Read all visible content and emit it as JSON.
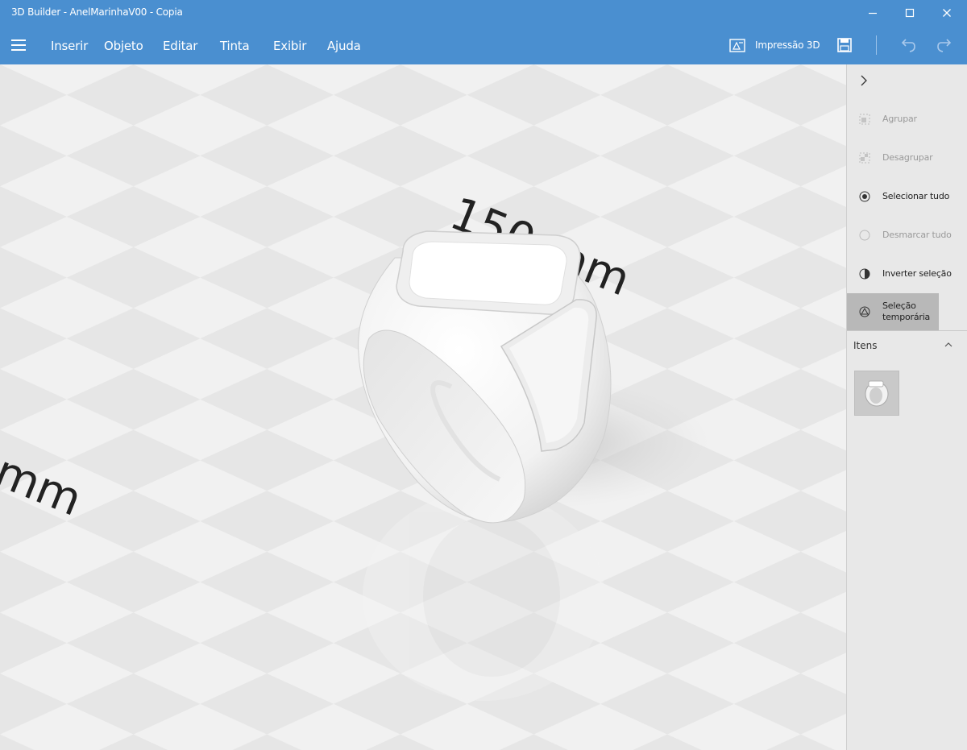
{
  "window": {
    "title": "3D Builder - AnelMarinhaV00 - Copia"
  },
  "menu": {
    "items": [
      "Inserir",
      "Objeto",
      "Editar",
      "Tinta",
      "Exibir",
      "Ajuda"
    ],
    "print_label": "Impressão 3D"
  },
  "viewport": {
    "ruler_text_right": "150 mm",
    "ruler_text_left": "mm"
  },
  "pane": {
    "items": [
      {
        "label": "Agrupar",
        "enabled": false,
        "icon": "group-icon"
      },
      {
        "label": "Desagrupar",
        "enabled": false,
        "icon": "ungroup-icon"
      },
      {
        "label": "Selecionar tudo",
        "enabled": true,
        "icon": "select-all-icon"
      },
      {
        "label": "Desmarcar tudo",
        "enabled": false,
        "icon": "deselect-all-icon"
      },
      {
        "label": "Inverter seleção",
        "enabled": true,
        "icon": "invert-selection-icon"
      },
      {
        "label": "Seleção temporária",
        "enabled": true,
        "active": true,
        "icon": "temporary-selection-icon"
      }
    ],
    "items_header": "Itens"
  },
  "colors": {
    "accent": "#4a8fd0",
    "pane_bg": "#e8e8e8",
    "viewport_bg": "#e6e6e6"
  }
}
